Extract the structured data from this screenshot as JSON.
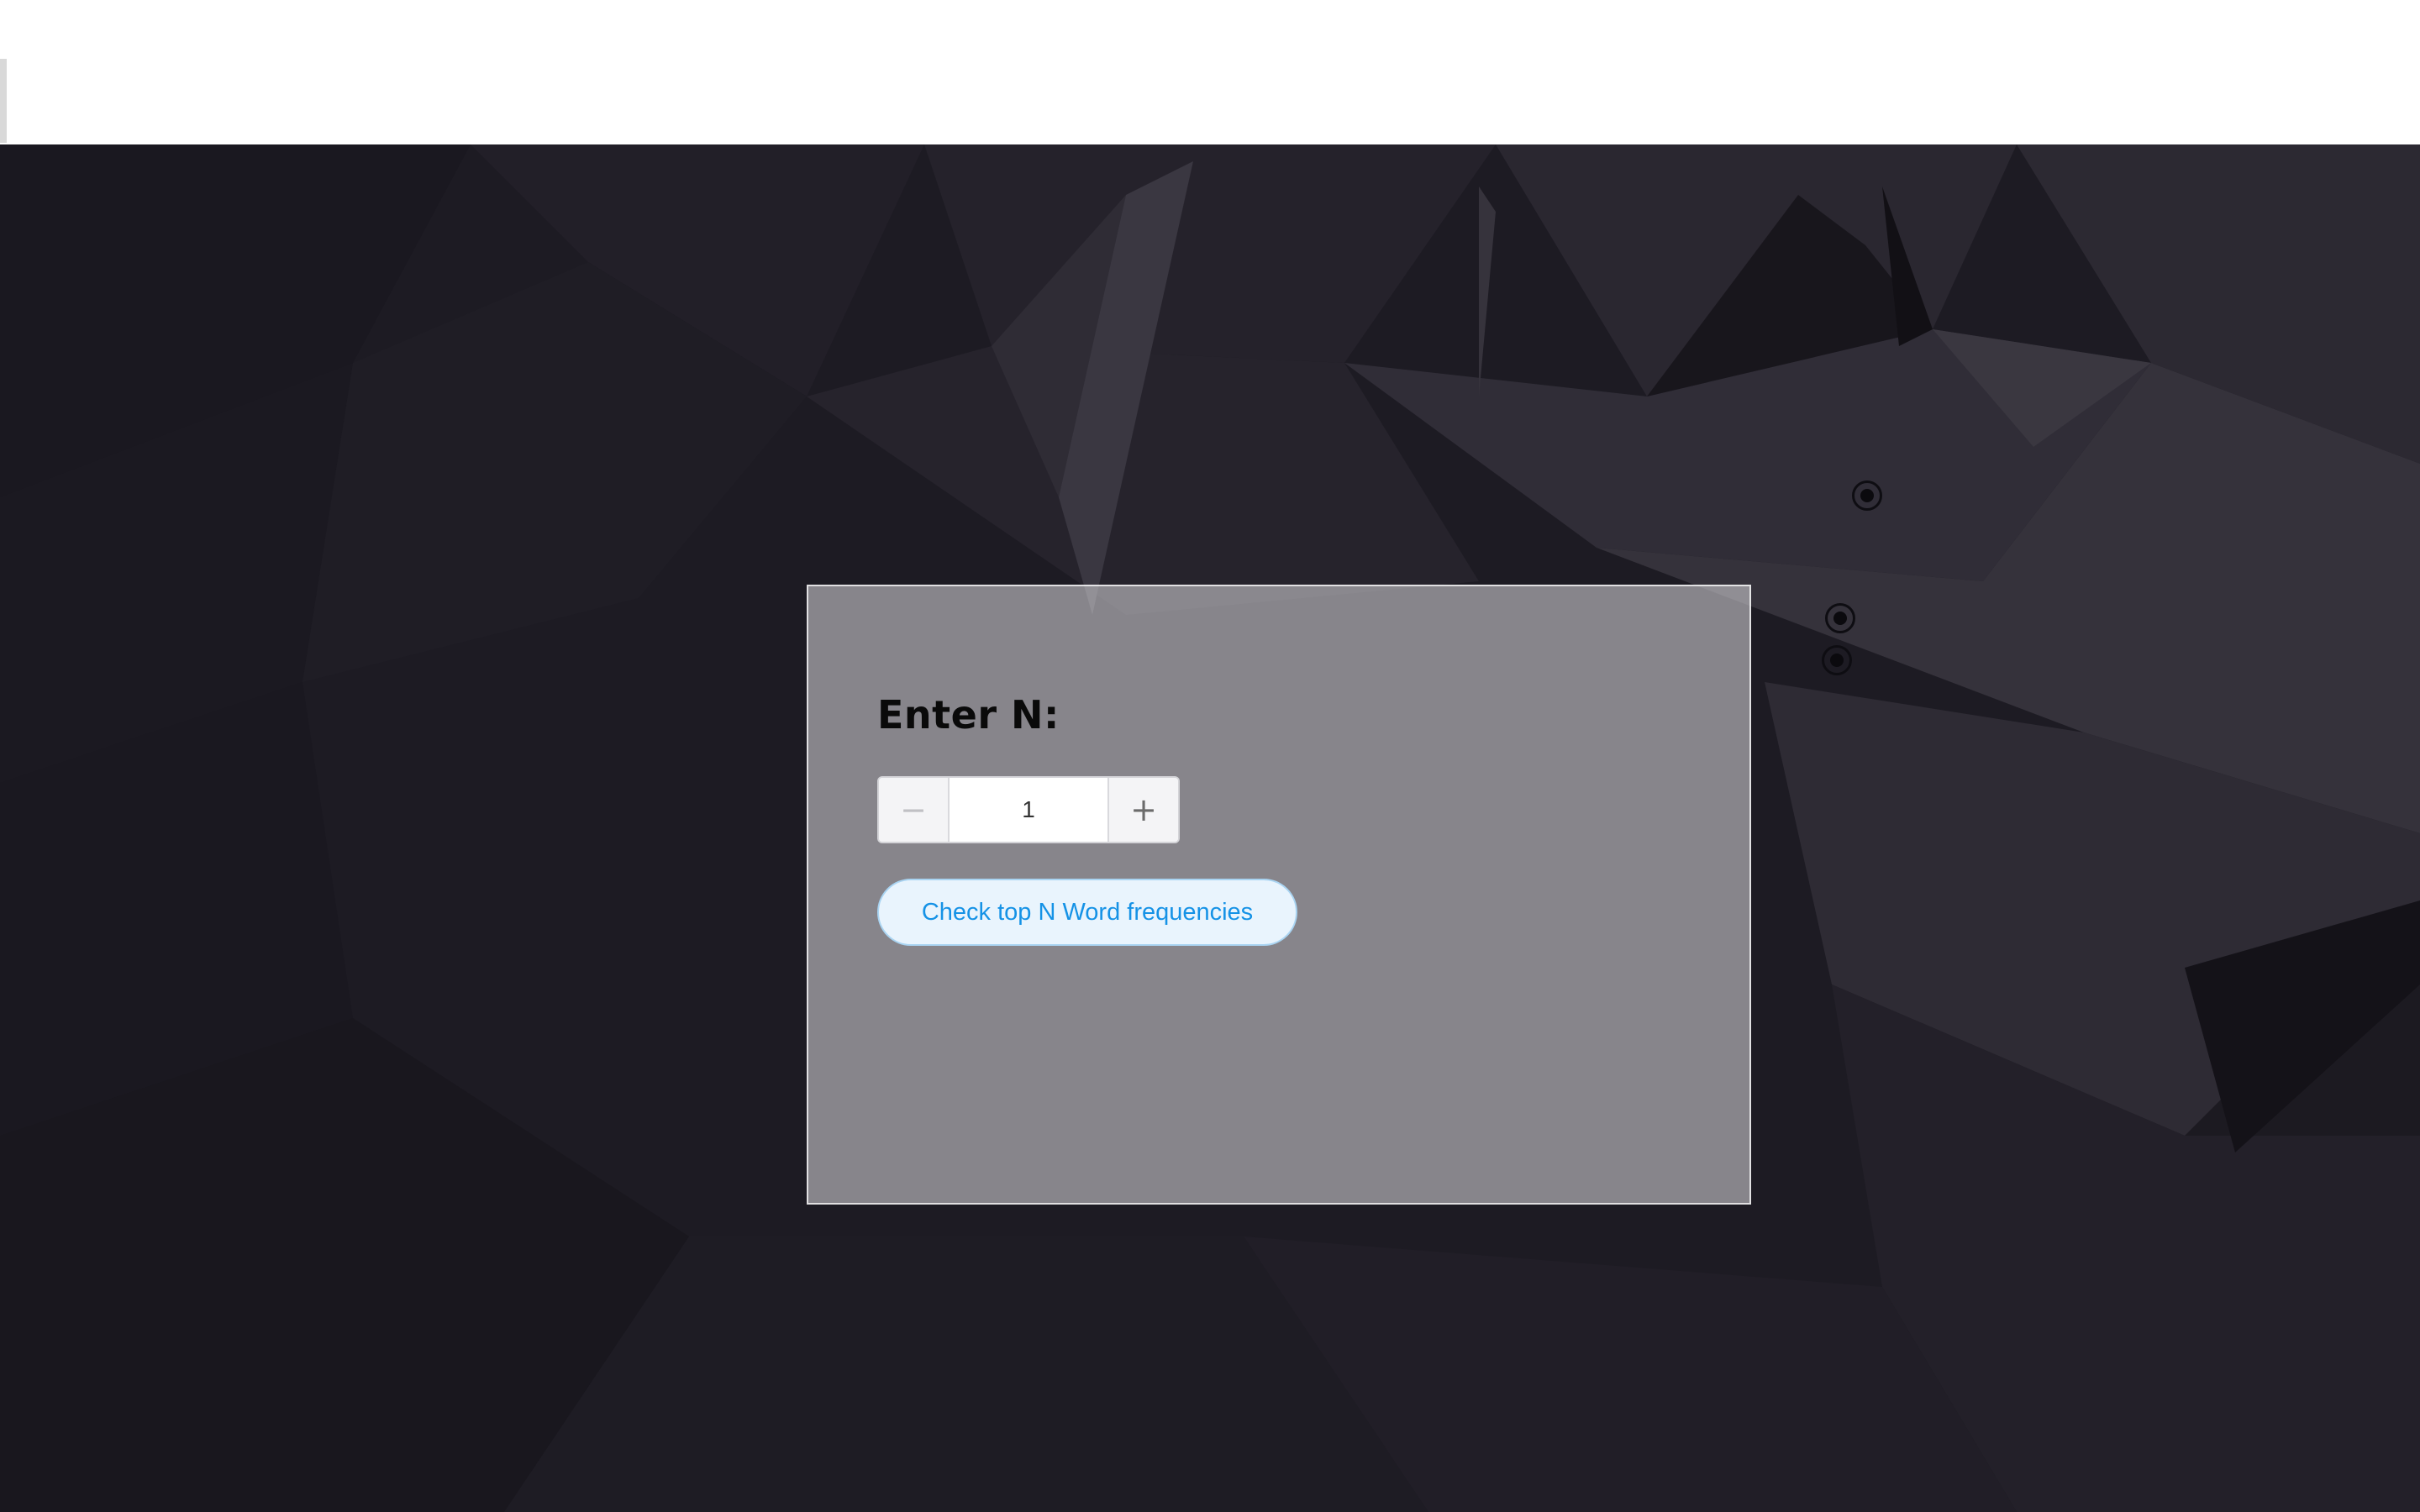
{
  "form": {
    "label": "Enter N:",
    "stepper": {
      "value": "1",
      "decrement_symbol": "−",
      "increment_symbol": "+"
    },
    "submit_label": "Check top N Word frequencies"
  },
  "colors": {
    "background": "#1d1b23",
    "card": "#8a888e",
    "button_bg": "#e9f4fd",
    "button_text": "#1592e6"
  },
  "icons": {
    "decrement": "minus-icon",
    "increment": "plus-icon",
    "markers": "radio-dot-icon"
  }
}
